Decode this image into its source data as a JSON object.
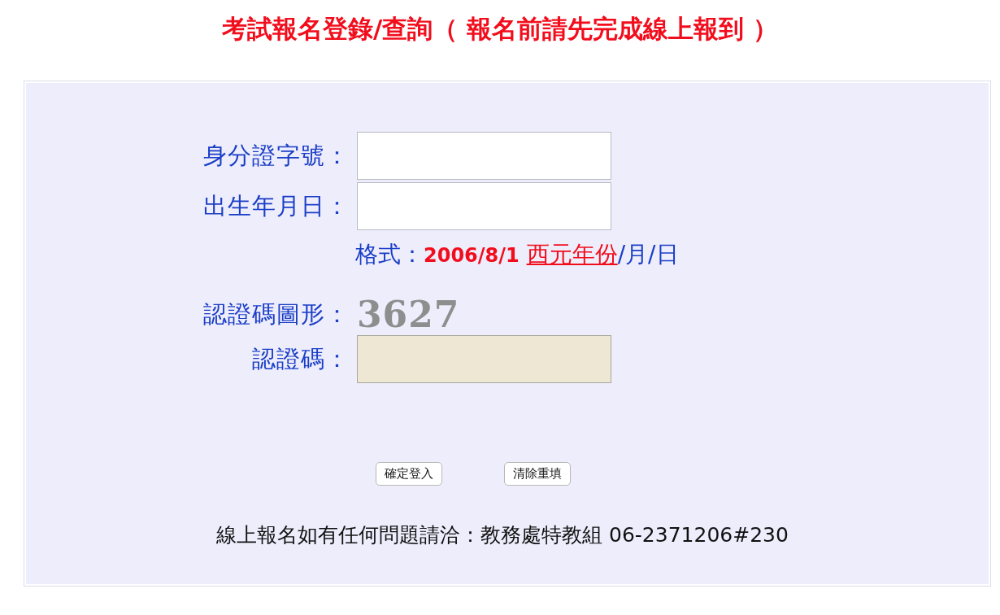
{
  "title": "考試報名登錄/查詢（ 報名前請先完成線上報到 ）",
  "form": [
    {
      "kind": "text",
      "label": "身分證字號："
    },
    {
      "kind": "text",
      "label": "出生年月日："
    },
    {
      "kind": "hint",
      "label": "格式：",
      "example": "2006/8/1",
      "link": "西元年份",
      "suffix": "/月/日"
    },
    {
      "kind": "captcha",
      "label": "認證碼圖形：",
      "captcha": "3627"
    },
    {
      "kind": "code",
      "label": "認證碼："
    }
  ],
  "buttons": [
    "確定登入",
    "清除重填"
  ],
  "footer": "線上報名如有任何問題請洽：教務處特教組 06-2371206#230"
}
